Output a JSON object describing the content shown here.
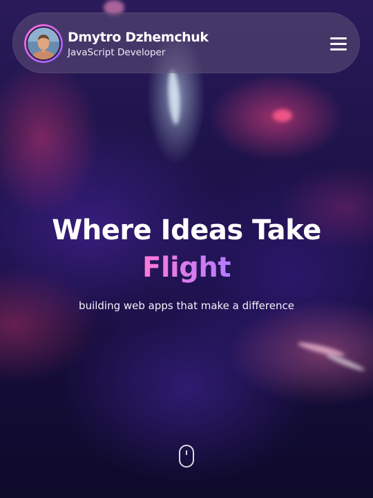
{
  "header": {
    "name": "Dmytro Dzhemchuk",
    "role": "JavaScript Developer",
    "avatar_icon": "person-avatar",
    "menu_icon": "hamburger-menu-icon"
  },
  "hero": {
    "title_line1": "Where Ideas Take",
    "title_line2": "Flight",
    "subtitle": "building web apps that make a difference"
  },
  "scroll_indicator": {
    "icon": "mouse-scroll-icon"
  },
  "colors": {
    "accent_gradient_start": "#ff7ad8",
    "accent_gradient_end": "#b47cff",
    "background": "#150d3a"
  }
}
